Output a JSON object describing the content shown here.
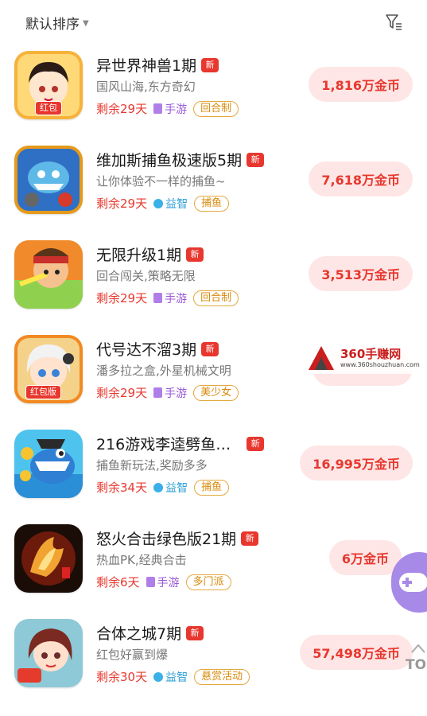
{
  "header": {
    "sort_label": "默认排序",
    "sort_icon": "caret-down-icon",
    "filter_icon": "filter-icon"
  },
  "colors": {
    "accent_red": "#e8372e",
    "reward_bg": "#fde6e5",
    "mobile_purple": "#9a5ad8",
    "puzzle_blue": "#2d9fd8",
    "genre_orange": "#d88a0c"
  },
  "games": [
    {
      "title": "异世界神兽1期",
      "new_badge": "新",
      "desc": "国风山海,东方奇幻",
      "remain": "剩余29天",
      "platform": "手游",
      "platform_type": "mobile",
      "genre": "回合制",
      "reward": "1,816万金币",
      "icon_tag": "红包"
    },
    {
      "title": "维加斯捕鱼极速版5期",
      "new_badge": "新",
      "desc": "让你体验不一样的捕鱼~",
      "remain": "剩余29天",
      "platform": "益智",
      "platform_type": "puzzle",
      "genre": "捕鱼",
      "reward": "7,618万金币",
      "icon_tag": ""
    },
    {
      "title": "无限升级1期",
      "new_badge": "新",
      "desc": "回合闯关,策略无限",
      "remain": "剩余29天",
      "platform": "手游",
      "platform_type": "mobile",
      "genre": "回合制",
      "reward": "3,513万金币",
      "icon_tag": ""
    },
    {
      "title": "代号达不溜3期",
      "new_badge": "新",
      "desc": "潘多拉之盒,外星机械文明",
      "remain": "剩余29天",
      "platform": "手游",
      "platform_type": "mobile",
      "genre": "美少女",
      "reward": "",
      "icon_tag": "红包版"
    },
    {
      "title": "216游戏李逵劈鱼…",
      "new_badge": "新",
      "desc": "捕鱼新玩法,奖励多多",
      "remain": "剩余34天",
      "platform": "益智",
      "platform_type": "puzzle",
      "genre": "捕鱼",
      "reward": "16,995万金币",
      "icon_tag": ""
    },
    {
      "title": "怒火合击绿色版21期",
      "new_badge": "新",
      "desc": "热血PK,经典合击",
      "remain": "剩余6天",
      "platform": "手游",
      "platform_type": "mobile",
      "genre": "多门派",
      "reward": "6万金币",
      "icon_tag": ""
    },
    {
      "title": "合体之城7期",
      "new_badge": "新",
      "desc": "红包好赢到爆",
      "remain": "剩余30天",
      "platform": "益智",
      "platform_type": "puzzle",
      "genre": "悬赏活动",
      "reward": "57,498万金币",
      "icon_tag": ""
    }
  ],
  "watermark": {
    "title": "360手赚网",
    "url": "www.360shouzhuan.com"
  },
  "float_button_icon": "gamepad-icon",
  "to_top": {
    "label": "TO",
    "icon": "chevron-up-icon"
  }
}
